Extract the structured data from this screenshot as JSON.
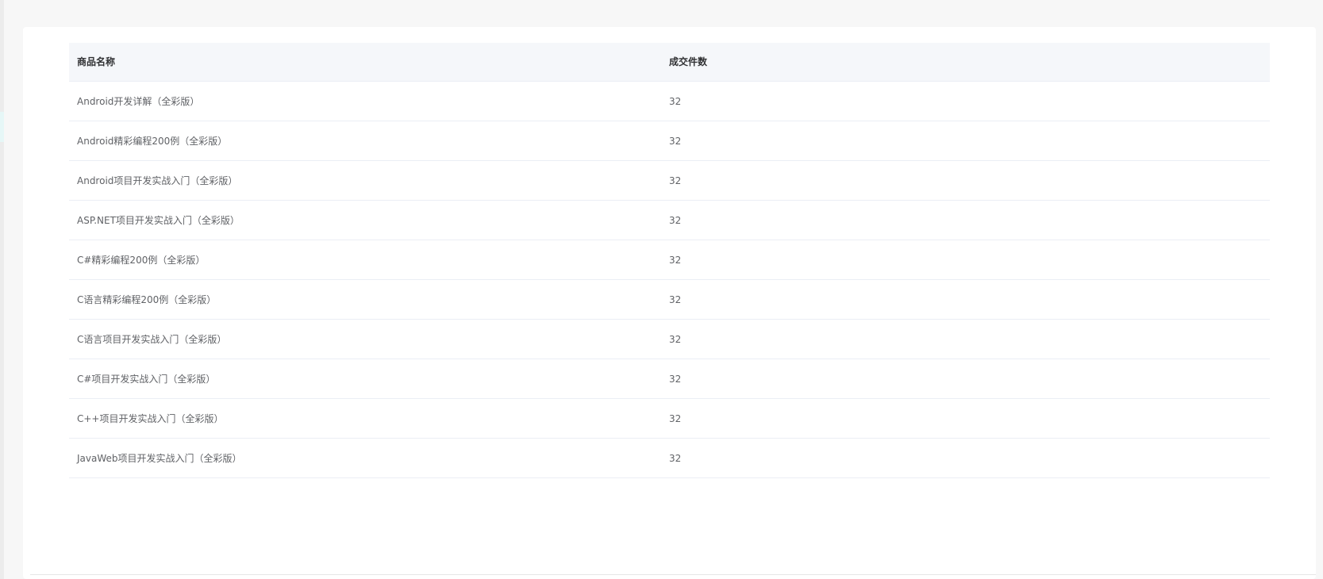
{
  "table": {
    "headers": {
      "name": "商品名称",
      "count": "成交件数"
    },
    "rows": [
      {
        "name": "Android开发详解（全彩版）",
        "count": "32"
      },
      {
        "name": "Android精彩编程200例（全彩版）",
        "count": "32"
      },
      {
        "name": "Android项目开发实战入门（全彩版）",
        "count": "32"
      },
      {
        "name": "ASP.NET项目开发实战入门（全彩版）",
        "count": "32"
      },
      {
        "name": "C#精彩编程200例（全彩版）",
        "count": "32"
      },
      {
        "name": "C语言精彩编程200例（全彩版）",
        "count": "32"
      },
      {
        "name": "C语言项目开发实战入门（全彩版）",
        "count": "32"
      },
      {
        "name": "C#项目开发实战入门（全彩版）",
        "count": "32"
      },
      {
        "name": "C++项目开发实战入门（全彩版）",
        "count": "32"
      },
      {
        "name": "JavaWeb项目开发实战入门（全彩版）",
        "count": "32"
      }
    ]
  },
  "colors": {
    "page_bg": "#f7f7f7",
    "panel_bg": "#ffffff",
    "header_bg": "#f5f7fa",
    "row_border": "#ebeef5",
    "header_text": "#303133",
    "cell_text": "#606266"
  }
}
